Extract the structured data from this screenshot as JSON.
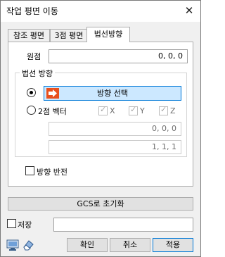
{
  "window": {
    "title": "작업 평면 이동",
    "close_glyph": "✕"
  },
  "tabs": [
    {
      "label": "참조 평면"
    },
    {
      "label": "3점 평면"
    },
    {
      "label": "법선방향"
    }
  ],
  "origin": {
    "label": "원점",
    "value": "0, 0, 0"
  },
  "normal_group": {
    "title": "법선 방향",
    "pick_direction": {
      "label": "방향 선택",
      "icon": "arrow-pick-icon",
      "selected": true
    },
    "two_point": {
      "label": "2점 벡터",
      "selected": false,
      "axes": [
        {
          "label": "X",
          "checked": true
        },
        {
          "label": "Y",
          "checked": true
        },
        {
          "label": "Z",
          "checked": true
        }
      ],
      "point1": "0, 0, 0",
      "point2": "1, 1, 1"
    }
  },
  "reverse": {
    "label": "방향 반전",
    "checked": false
  },
  "reset_button": {
    "label": "GCS로 초기화"
  },
  "save": {
    "label": "저장",
    "checked": false,
    "value": ""
  },
  "footer": {
    "confirm": "확인",
    "cancel": "취소",
    "apply": "적용"
  },
  "colors": {
    "accent": "#0078d7",
    "pick_button_bg": "#cce8ff",
    "icon_orange": "#e8501e"
  }
}
